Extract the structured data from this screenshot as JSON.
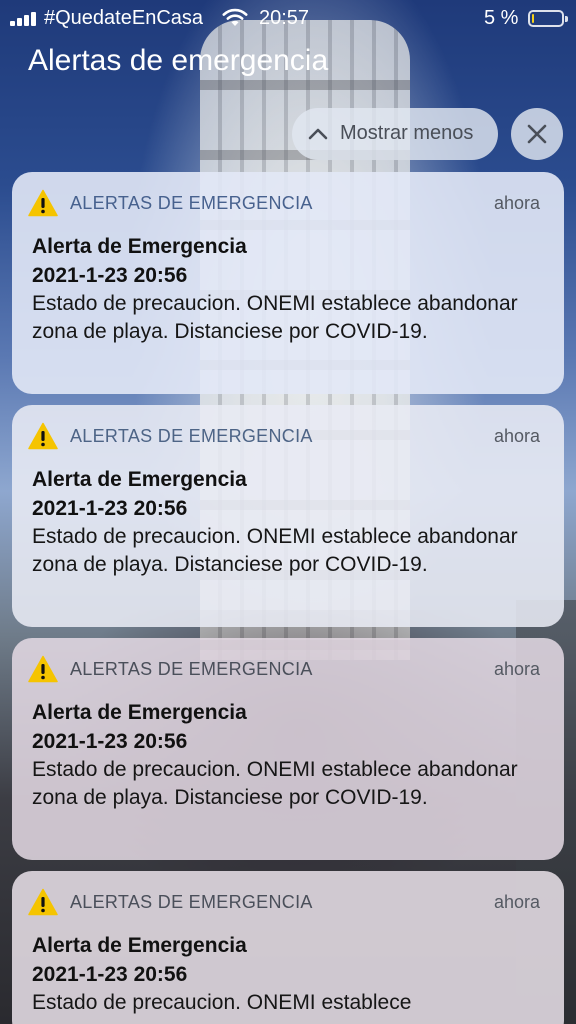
{
  "status_bar": {
    "carrier": "#QuedateEnCasa",
    "time": "20:57",
    "battery_percent": "5 %",
    "battery_level": 0.05,
    "battery_color": "#f5d11a",
    "signal_bars": 4
  },
  "screen": {
    "title": "Alertas de emergencia",
    "show_less_label": "Mostrar menos"
  },
  "icons": {
    "warning": "warning-triangle-icon",
    "chevron": "chevron-up-icon",
    "close": "close-icon",
    "wifi": "wifi-icon"
  },
  "colors": {
    "warning_yellow": "#f5c400"
  },
  "notifications": [
    {
      "app_name": "ALERTAS DE EMERGENCIA",
      "time": "ahora",
      "title": "Alerta de Emergencia",
      "date": "2021-1-23 20:56",
      "body": "Estado de precaucion. ONEMI establece abandonar zona de playa. Distanciese por COVID-19."
    },
    {
      "app_name": "ALERTAS DE EMERGENCIA",
      "time": "ahora",
      "title": "Alerta de Emergencia",
      "date": "2021-1-23 20:56",
      "body": "Estado de precaucion. ONEMI establece abandonar zona de playa. Distanciese por COVID-19."
    },
    {
      "app_name": "ALERTAS DE EMERGENCIA",
      "time": "ahora",
      "title": "Alerta de Emergencia",
      "date": "2021-1-23 20:56",
      "body": "Estado de precaucion. ONEMI establece abandonar zona de playa. Distanciese por COVID-19."
    },
    {
      "app_name": "ALERTAS DE EMERGENCIA",
      "time": "ahora",
      "title": "Alerta de Emergencia",
      "date": "2021-1-23 20:56",
      "body": "Estado de precaucion. ONEMI establece"
    }
  ]
}
